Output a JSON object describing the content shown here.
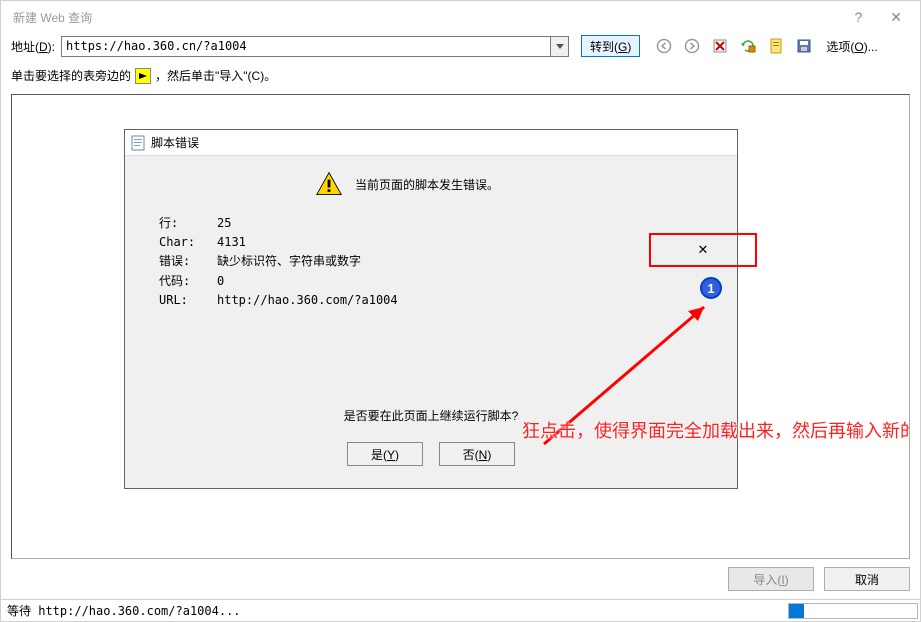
{
  "window": {
    "title": "新建 Web 查询",
    "help_glyph": "?",
    "close_glyph": "✕"
  },
  "addrbar": {
    "label_html": "地址(D):",
    "url": "https://hao.360.cn/?a1004",
    "go_label": "转到(G)",
    "options_label": "选项(O)..."
  },
  "instruction": {
    "prefix": "单击要选择的表旁边的",
    "suffix": "，然后单击\"导入\"(C)。"
  },
  "dialog": {
    "title": "脚本错误",
    "message": "当前页面的脚本发生错误。",
    "details": {
      "line_label": "行:",
      "line_value": "25",
      "char_label": "Char:",
      "char_value": "4131",
      "error_label": "错误:",
      "error_value": "缺少标识符、字符串或数字",
      "code_label": "代码:",
      "code_value": "0",
      "url_label": "URL:",
      "url_value": "http://hao.360.com/?a1004"
    },
    "question": "是否要在此页面上继续运行脚本?",
    "yes_label": "是(Y)",
    "no_label": "否(N)",
    "close_glyph": "✕"
  },
  "annotation": {
    "number": "1",
    "text": "狂点击，使得界面完全加载出来，然后再输入新的网址"
  },
  "bottom": {
    "import_label": "导入(I)",
    "cancel_label": "取消"
  },
  "status": {
    "text": "等待 http://hao.360.com/?a1004...",
    "progress_percent": 12
  },
  "colors": {
    "highlight_border": "#0078d7",
    "annot_red": "#ff0000",
    "annot_blue": "#0040c0"
  }
}
